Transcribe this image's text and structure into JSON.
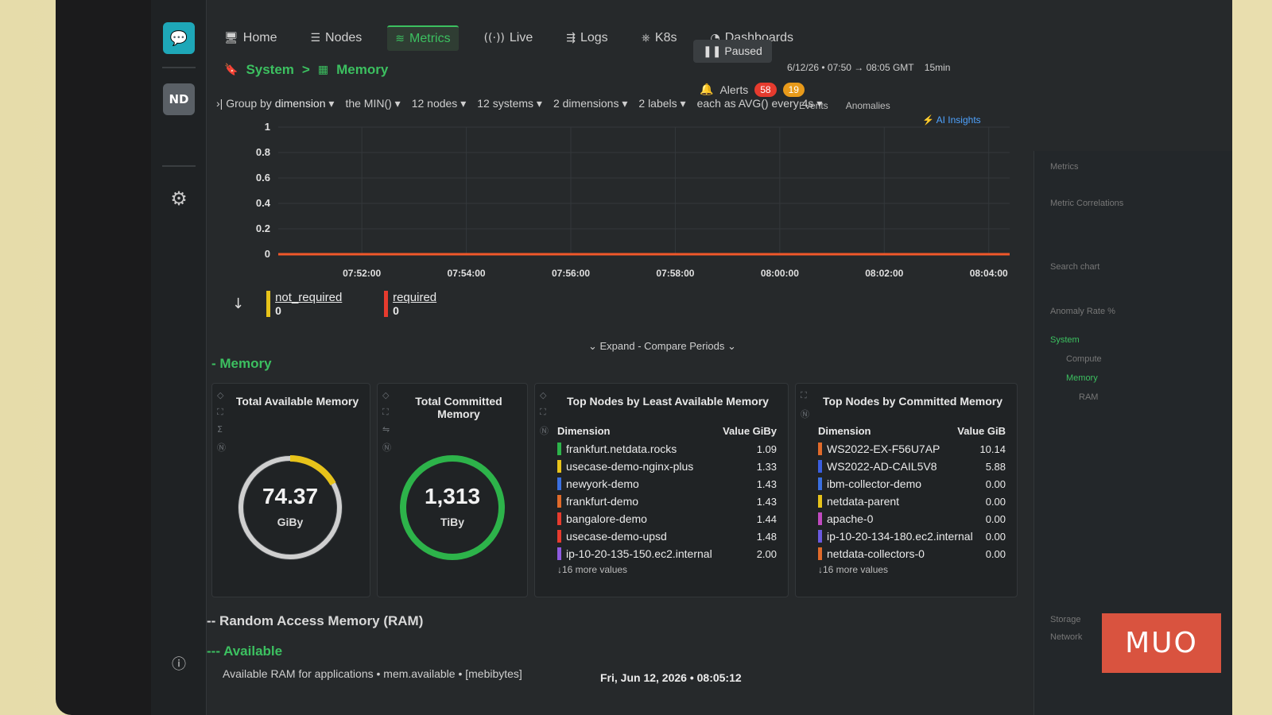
{
  "colors": {
    "accent": "#3cc060",
    "required": "#e63b2e",
    "not_required": "#e7c31a",
    "chart_line": "#f0582a"
  },
  "nav": {
    "home": "Home",
    "nodes": "Nodes",
    "metrics": "Metrics",
    "live": "Live",
    "logs": "Logs",
    "k8s": "K8s",
    "dashboards": "Dashboards",
    "alerts": "Alerts",
    "alerts_red": "58",
    "alerts_orange": "19",
    "events": "Events",
    "anomalies": "Anomalies",
    "insights": "AI Insights"
  },
  "sidebar": {
    "avatar": "ND"
  },
  "breadcrumb": {
    "system": "System",
    "sep": ">",
    "memory": "Memory"
  },
  "controls": {
    "paused": "Paused",
    "range": "6/12/26 • 07:50 → 08:05 GMT",
    "duration": "15min"
  },
  "groupbar": {
    "group_by": "Group by",
    "dimension": "dimension",
    "the_min": "the MIN()",
    "nodes": "12 nodes",
    "systems": "12 systems",
    "dimensions": "2 dimensions",
    "labels": "2 labels",
    "agg": "each as AVG() every 4s"
  },
  "chart_data": {
    "type": "line",
    "x": [
      "07:52:00",
      "07:54:00",
      "07:56:00",
      "07:58:00",
      "08:00:00",
      "08:02:00",
      "08:04:00"
    ],
    "y_ticks": [
      "1",
      "0.8",
      "0.6",
      "0.4",
      "0.2",
      "0"
    ],
    "ylim": [
      0,
      1
    ],
    "series": [
      {
        "name": "not_required",
        "values": [
          0,
          0,
          0,
          0,
          0,
          0,
          0
        ]
      },
      {
        "name": "required",
        "values": [
          0,
          0,
          0,
          0,
          0,
          0,
          0
        ]
      }
    ],
    "grid": true
  },
  "dims": [
    {
      "name": "not_required",
      "value": "0"
    },
    {
      "name": "required",
      "value": "0"
    }
  ],
  "expand": "Expand - Compare Periods",
  "section": "Memory",
  "cards": {
    "available": {
      "title": "Total Available Memory",
      "value": "74.37",
      "unit": "GiBy"
    },
    "committed": {
      "title": "Total Committed Memory",
      "value": "1,313",
      "unit": "TiBy"
    }
  },
  "least_available": {
    "title": "Top Nodes by Least Available Memory",
    "col_dim": "Dimension",
    "col_val": "Value GiBy",
    "rows": [
      {
        "name": "frankfurt.netdata.rocks",
        "value": "1.09",
        "color": "#2db34a"
      },
      {
        "name": "usecase-demo-nginx-plus",
        "value": "1.33",
        "color": "#e7c31a"
      },
      {
        "name": "newyork-demo",
        "value": "1.43",
        "color": "#3a6fe0"
      },
      {
        "name": "frankfurt-demo",
        "value": "1.43",
        "color": "#e06a2a"
      },
      {
        "name": "bangalore-demo",
        "value": "1.44",
        "color": "#e63b2e"
      },
      {
        "name": "usecase-demo-upsd",
        "value": "1.48",
        "color": "#e63b2e"
      },
      {
        "name": "ip-10-20-135-150.ec2.internal",
        "value": "2.00",
        "color": "#8e5ae0"
      }
    ],
    "more": "↓16 more values"
  },
  "committed_table": {
    "title": "Top Nodes by Committed Memory",
    "col_dim": "Dimension",
    "col_val": "Value GiB",
    "rows": [
      {
        "name": "WS2022-EX-F56U7AP",
        "value": "10.14",
        "color": "#e06a2a"
      },
      {
        "name": "WS2022-AD-CAIL5V8",
        "value": "5.88",
        "color": "#3a5ee0"
      },
      {
        "name": "ibm-collector-demo",
        "value": "0.00",
        "color": "#3a6fe0"
      },
      {
        "name": "netdata-parent",
        "value": "0.00",
        "color": "#e7c31a"
      },
      {
        "name": "apache-0",
        "value": "0.00",
        "color": "#c04ac0"
      },
      {
        "name": "ip-10-20-134-180.ec2.internal",
        "value": "0.00",
        "color": "#6a5ae0"
      },
      {
        "name": "netdata-collectors-0",
        "value": "0.00",
        "color": "#e06a2a"
      }
    ],
    "more": "↓16 more values"
  },
  "right": {
    "metrics": "Metrics",
    "correlations": "Metric Correlations",
    "search": "Search chart",
    "anomaly": "Anomaly Rate %",
    "system": "System",
    "compute": "Compute",
    "memory": "Memory",
    "ram": "RAM",
    "storage": "Storage",
    "network": "Network"
  },
  "ram_title": "-- Random Access Memory (RAM)",
  "avail_title": "--- Available",
  "avail_desc": "Available RAM for applications • mem.available • [mebibytes]",
  "timestamp": "Fri, Jun 12, 2026 • 08:05:12",
  "watermark": "MUO"
}
